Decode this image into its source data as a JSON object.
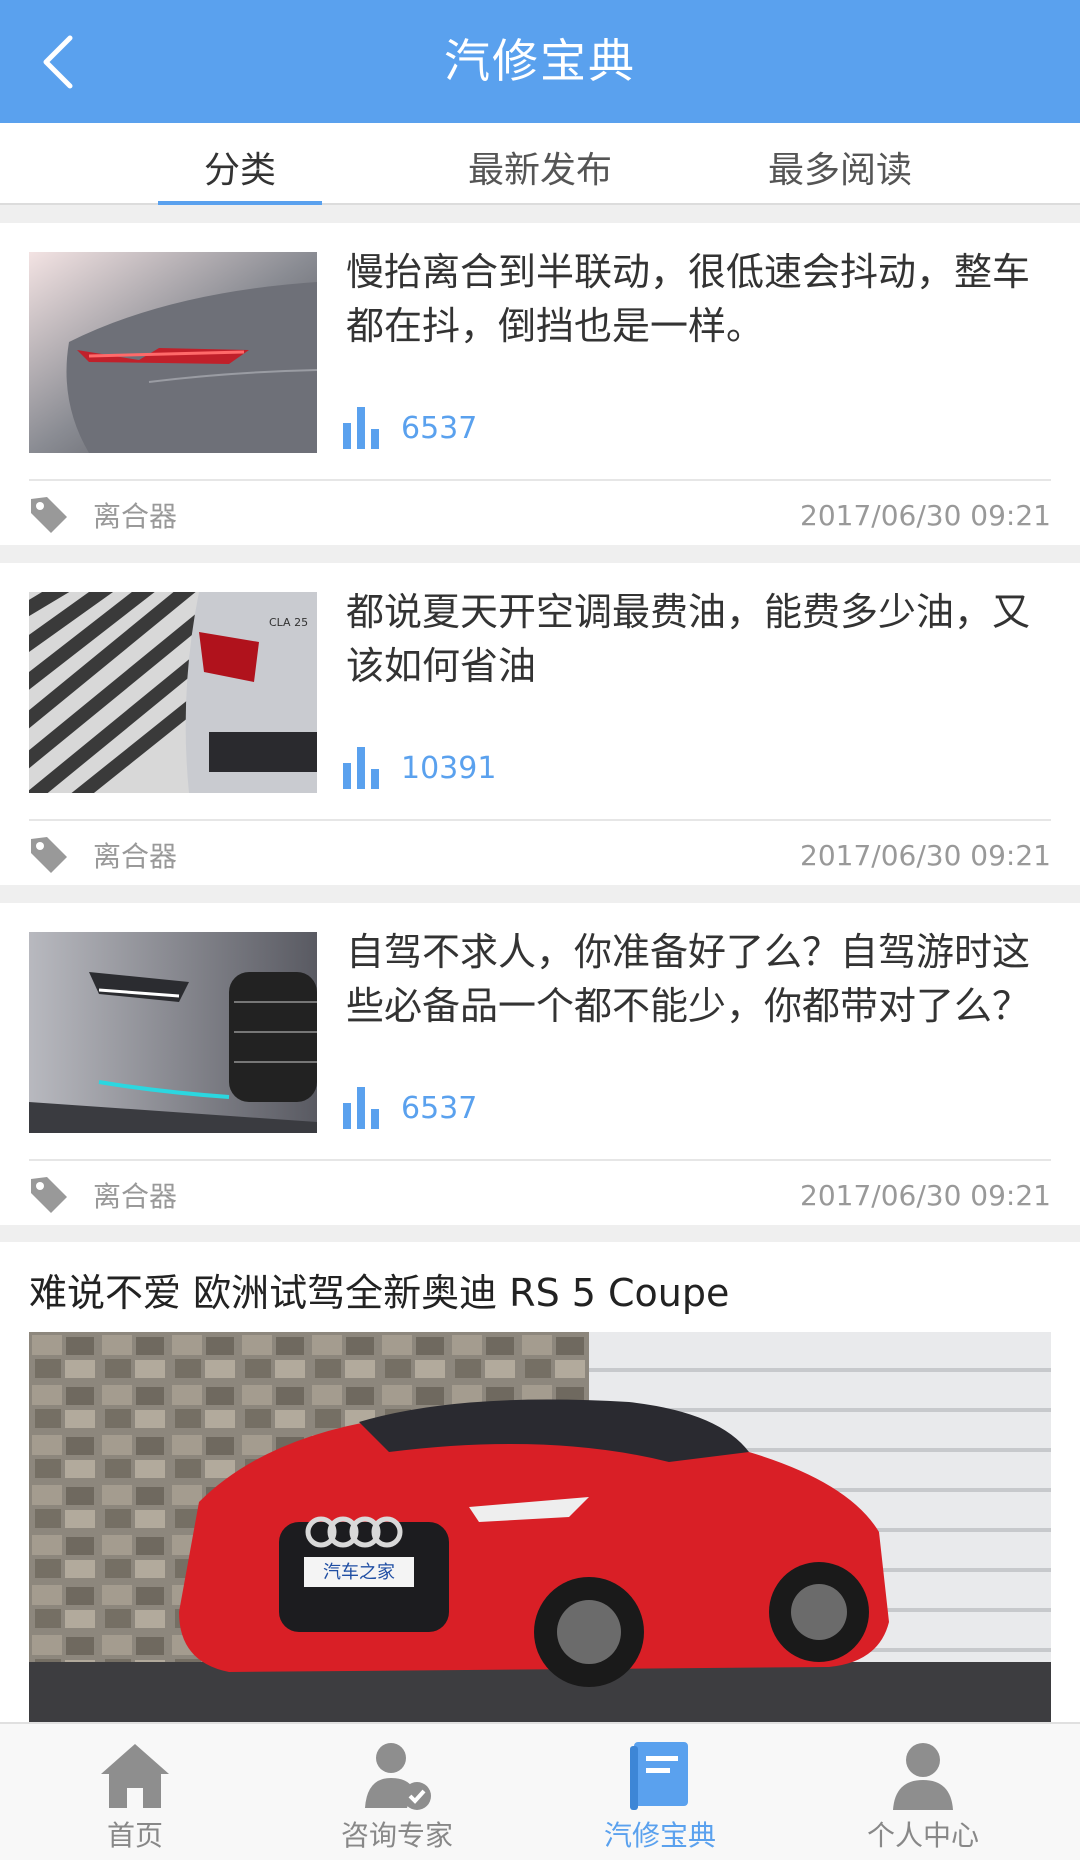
{
  "header": {
    "title": "汽修宝典"
  },
  "tabs": [
    {
      "label": "分类",
      "active": true
    },
    {
      "label": "最新发布",
      "active": false
    },
    {
      "label": "最多阅读",
      "active": false
    }
  ],
  "articles": [
    {
      "title": "慢抬离合到半联动，很低速会抖动，整车都在抖，倒挡也是一样。",
      "views": "6537",
      "tag": "离合器",
      "date": "2017/06/30 09:21"
    },
    {
      "title": "都说夏天开空调最费油，能费多少油，又该如何省油",
      "views": "10391",
      "tag": "离合器",
      "date": "2017/06/30 09:21"
    },
    {
      "title": "自驾不求人，你准备好了么？自驾游时这些必备品一个都不能少，你都带对了么？",
      "views": "6537",
      "tag": "离合器",
      "date": "2017/06/30 09:21"
    }
  ],
  "featured": {
    "title": "难说不爱 欧洲试驾全新奥迪 RS 5 Coupe",
    "image_text": "汽车之家"
  },
  "bottom_nav": [
    {
      "label": "首页",
      "icon": "home-icon",
      "active": false
    },
    {
      "label": "咨询专家",
      "icon": "expert-icon",
      "active": false
    },
    {
      "label": "汽修宝典",
      "icon": "book-icon",
      "active": true
    },
    {
      "label": "个人中心",
      "icon": "user-icon",
      "active": false
    }
  ],
  "colors": {
    "accent": "#5aa1ee",
    "background": "#efefef",
    "muted": "#999999"
  }
}
